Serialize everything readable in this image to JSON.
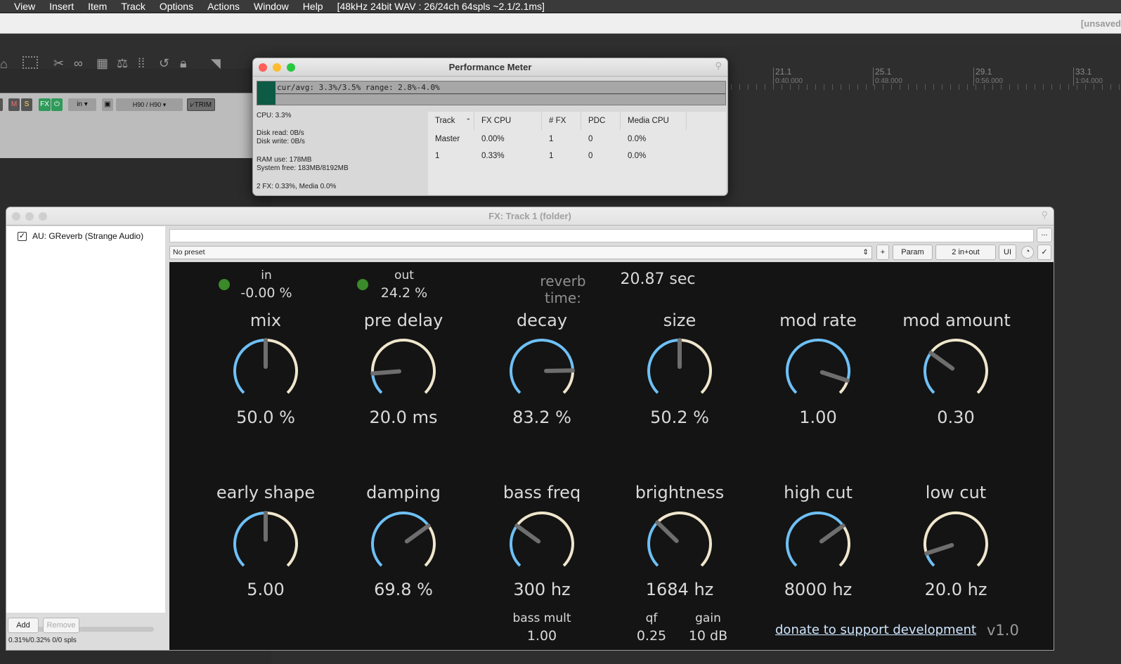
{
  "menu": {
    "items": [
      "View",
      "Insert",
      "Item",
      "Track",
      "Options",
      "Actions",
      "Window",
      "Help"
    ],
    "info": "[48kHz 24bit WAV : 26/24ch 64spls ~2.1/2.1ms]"
  },
  "titlebar": {
    "unsaved": "[unsaved"
  },
  "ruler": [
    {
      "bar": "21.1",
      "time": "0:40.000"
    },
    {
      "bar": "25.1",
      "time": "0:48.000"
    },
    {
      "bar": "29.1",
      "time": "0:56.000"
    },
    {
      "bar": "33.1",
      "time": "1:04.000"
    }
  ],
  "track": {
    "mute": "M",
    "solo": "S",
    "fx": "FX",
    "in": "in",
    "device": "H90 / H90",
    "trim": "TRIM"
  },
  "perf": {
    "title": "Performance Meter",
    "cpu_text": "cur/avg: 3.3%/3.5%  range: 2.8%-4.0%",
    "stats": {
      "cpu": "CPU: 3.3%",
      "disk_read": "Disk read: 0B/s",
      "disk_write": "Disk write: 0B/s",
      "ram": "RAM use: 178MB",
      "system_free": "System free: 183MB/8192MB",
      "fx_summary": "2 FX: 0.33%, Media 0.0%"
    },
    "headers": [
      "Track",
      "FX CPU",
      "# FX",
      "PDC",
      "Media CPU"
    ],
    "rows": [
      [
        "Master",
        "0.00%",
        "1",
        "0",
        "0.0%"
      ],
      [
        "1",
        "0.33%",
        "1",
        "0",
        "0.0%"
      ]
    ]
  },
  "fx": {
    "title": "FX: Track 1 (folder)",
    "plugin_name": "AU: GReverb (Strange Audio)",
    "add": "Add",
    "remove": "Remove",
    "status": "0.31%/0.32% 0/0 spls",
    "preset": "No preset",
    "plus": "+",
    "param": "Param",
    "io": "2 in+out",
    "ui": "UI",
    "more": "..."
  },
  "plugin": {
    "in_label": "in",
    "in_value": "-0.00 %",
    "out_label": "out",
    "out_value": "24.2 %",
    "reverb_label": "reverb time:",
    "reverb_value": "20.87 sec",
    "knobs": [
      {
        "name": "mix",
        "value": "50.0 %",
        "level": 0.5
      },
      {
        "name": "pre delay",
        "value": "20.0 ms",
        "level": 0.15
      },
      {
        "name": "decay",
        "value": "83.2 %",
        "level": 0.83
      },
      {
        "name": "size",
        "value": "50.2 %",
        "level": 0.5
      },
      {
        "name": "mod rate",
        "value": "1.00",
        "level": 0.9
      },
      {
        "name": "mod amount",
        "value": "0.30",
        "level": 0.3
      },
      {
        "name": "early shape",
        "value": "5.00",
        "level": 0.5
      },
      {
        "name": "damping",
        "value": "69.8 %",
        "level": 0.7
      },
      {
        "name": "bass freq",
        "value": "300 hz",
        "level": 0.3
      },
      {
        "name": "brightness",
        "value": "1684 hz",
        "level": 0.33
      },
      {
        "name": "high cut",
        "value": "8000 hz",
        "level": 0.7
      },
      {
        "name": "low cut",
        "value": "20.0 hz",
        "level": 0.1
      }
    ],
    "bass_mult_label": "bass mult",
    "bass_mult_value": "1.00",
    "qf_label": "qf",
    "qf_value": "0.25",
    "gain_label": "gain",
    "gain_value": "10 dB",
    "donate": "donate to support development",
    "version": "v1.0",
    "colors": {
      "active": "#6ec0f5",
      "rest": "#efe6cc",
      "pointer": "#6e6e6e",
      "led": "#3a8a2a"
    }
  }
}
